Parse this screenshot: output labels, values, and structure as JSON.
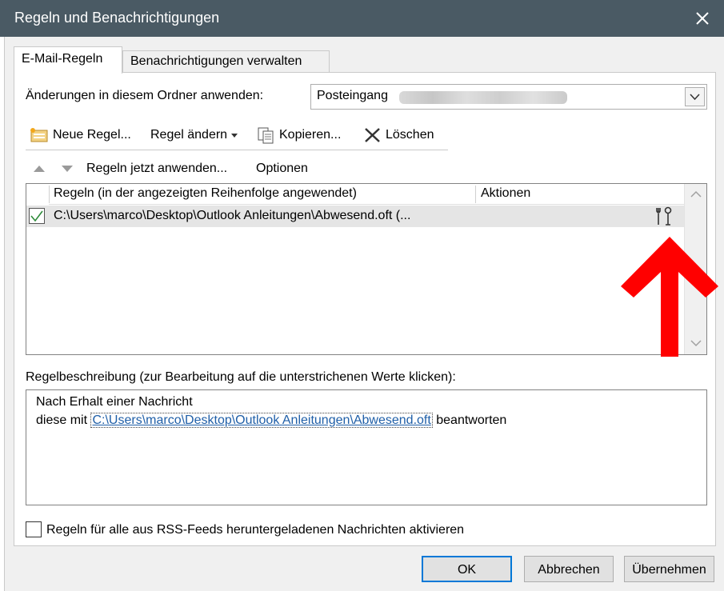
{
  "window": {
    "title": "Regeln und Benachrichtigungen"
  },
  "tabs": [
    {
      "label": "E-Mail-Regeln",
      "active": true
    },
    {
      "label": "Benachrichtigungen verwalten",
      "active": false
    }
  ],
  "folder": {
    "label": "Änderungen in diesem Ordner anwenden:",
    "selected": "Posteingang"
  },
  "toolbar": {
    "new_rule": "Neue Regel...",
    "change_rule": "Regel ändern",
    "copy": "Kopieren...",
    "delete": "Löschen",
    "apply_now": "Regeln jetzt anwenden...",
    "options": "Optionen"
  },
  "rules_table": {
    "headers": [
      "Regeln (in der angezeigten Reihenfolge angewendet)",
      "Aktionen"
    ],
    "rows": [
      {
        "checked": true,
        "name": "C:\\Users\\marco\\Desktop\\Outlook Anleitungen\\Abwesend.oft  (..."
      }
    ]
  },
  "description": {
    "label": "Regelbeschreibung (zur Bearbeitung auf die unterstrichenen Werte klicken):",
    "line1": "Nach Erhalt einer Nachricht",
    "line2_prefix": "diese mit ",
    "line2_link": "C:\\Users\\marco\\Desktop\\Outlook Anleitungen\\Abwesend.oft",
    "line2_suffix": " beantworten"
  },
  "rss": {
    "label": "Regeln für alle aus RSS-Feeds heruntergeladenen Nachrichten aktivieren",
    "checked": false
  },
  "buttons": {
    "ok": "OK",
    "cancel": "Abbrechen",
    "apply": "Übernehmen"
  },
  "colors": {
    "titlebar": "#4a5a64",
    "link": "#1f5fa8",
    "arrow": "#ff0000",
    "check": "#2e8b3a"
  }
}
